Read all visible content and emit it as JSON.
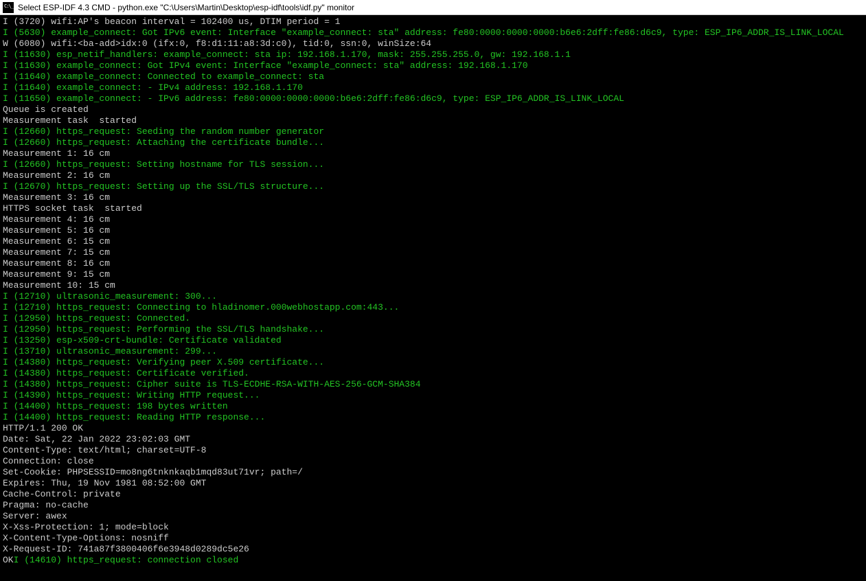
{
  "window": {
    "title": "Select ESP-IDF 4.3 CMD - python.exe  \"C:\\Users\\Martin\\Desktop\\esp-idf\\tools\\idf.py\" monitor"
  },
  "lines": [
    {
      "cls": "plain",
      "text": "I (3720) wifi:AP's beacon interval = 102400 us, DTIM period = 1"
    },
    {
      "cls": "info",
      "text": "I (5630) example_connect: Got IPv6 event: Interface \"example_connect: sta\" address: fe80:0000:0000:0000:b6e6:2dff:fe86:d6c9, type: ESP_IP6_ADDR_IS_LINK_LOCAL"
    },
    {
      "cls": "plain",
      "text": "W (6080) wifi:<ba-add>idx:0 (ifx:0, f8:d1:11:a8:3d:c0), tid:0, ssn:0, winSize:64"
    },
    {
      "cls": "info",
      "text": "I (11630) esp_netif_handlers: example_connect: sta ip: 192.168.1.170, mask: 255.255.255.0, gw: 192.168.1.1"
    },
    {
      "cls": "info",
      "text": "I (11630) example_connect: Got IPv4 event: Interface \"example_connect: sta\" address: 192.168.1.170"
    },
    {
      "cls": "info",
      "text": "I (11640) example_connect: Connected to example_connect: sta"
    },
    {
      "cls": "info",
      "text": "I (11640) example_connect: - IPv4 address: 192.168.1.170"
    },
    {
      "cls": "info",
      "text": "I (11650) example_connect: - IPv6 address: fe80:0000:0000:0000:b6e6:2dff:fe86:d6c9, type: ESP_IP6_ADDR_IS_LINK_LOCAL"
    },
    {
      "cls": "plain",
      "text": "Queue is created"
    },
    {
      "cls": "plain",
      "text": "Measurement task  started"
    },
    {
      "cls": "info",
      "text": "I (12660) https_request: Seeding the random number generator"
    },
    {
      "cls": "info",
      "text": "I (12660) https_request: Attaching the certificate bundle..."
    },
    {
      "cls": "plain",
      "text": "Measurement 1: 16 cm"
    },
    {
      "cls": "info",
      "text": "I (12660) https_request: Setting hostname for TLS session..."
    },
    {
      "cls": "plain",
      "text": "Measurement 2: 16 cm"
    },
    {
      "cls": "info",
      "text": "I (12670) https_request: Setting up the SSL/TLS structure..."
    },
    {
      "cls": "plain",
      "text": "Measurement 3: 16 cm"
    },
    {
      "cls": "plain",
      "text": "HTTPS socket task  started"
    },
    {
      "cls": "plain",
      "text": "Measurement 4: 16 cm"
    },
    {
      "cls": "plain",
      "text": "Measurement 5: 16 cm"
    },
    {
      "cls": "plain",
      "text": "Measurement 6: 15 cm"
    },
    {
      "cls": "plain",
      "text": "Measurement 7: 15 cm"
    },
    {
      "cls": "plain",
      "text": "Measurement 8: 16 cm"
    },
    {
      "cls": "plain",
      "text": "Measurement 9: 15 cm"
    },
    {
      "cls": "plain",
      "text": "Measurement 10: 15 cm"
    },
    {
      "cls": "info",
      "text": "I (12710) ultrasonic_measurement: 300..."
    },
    {
      "cls": "info",
      "text": "I (12710) https_request: Connecting to hladinomer.000webhostapp.com:443..."
    },
    {
      "cls": "info",
      "text": "I (12950) https_request: Connected."
    },
    {
      "cls": "info",
      "text": "I (12950) https_request: Performing the SSL/TLS handshake..."
    },
    {
      "cls": "info",
      "text": "I (13250) esp-x509-crt-bundle: Certificate validated"
    },
    {
      "cls": "info",
      "text": "I (13710) ultrasonic_measurement: 299..."
    },
    {
      "cls": "info",
      "text": "I (14380) https_request: Verifying peer X.509 certificate..."
    },
    {
      "cls": "info",
      "text": "I (14380) https_request: Certificate verified."
    },
    {
      "cls": "info",
      "text": "I (14380) https_request: Cipher suite is TLS-ECDHE-RSA-WITH-AES-256-GCM-SHA384"
    },
    {
      "cls": "info",
      "text": "I (14390) https_request: Writing HTTP request..."
    },
    {
      "cls": "info",
      "text": "I (14400) https_request: 198 bytes written"
    },
    {
      "cls": "info",
      "text": "I (14400) https_request: Reading HTTP response..."
    },
    {
      "cls": "plain",
      "text": "HTTP/1.1 200 OK"
    },
    {
      "cls": "plain",
      "text": "Date: Sat, 22 Jan 2022 23:02:03 GMT"
    },
    {
      "cls": "plain",
      "text": "Content-Type: text/html; charset=UTF-8"
    },
    {
      "cls": "plain",
      "text": "Connection: close"
    },
    {
      "cls": "plain",
      "text": "Set-Cookie: PHPSESSID=mo8ng6tnknkaqb1mqd83ut71vr; path=/"
    },
    {
      "cls": "plain",
      "text": "Expires: Thu, 19 Nov 1981 08:52:00 GMT"
    },
    {
      "cls": "plain",
      "text": "Cache-Control: private"
    },
    {
      "cls": "plain",
      "text": "Pragma: no-cache"
    },
    {
      "cls": "plain",
      "text": "Server: awex"
    },
    {
      "cls": "plain",
      "text": "X-Xss-Protection: 1; mode=block"
    },
    {
      "cls": "plain",
      "text": "X-Content-Type-Options: nosniff"
    },
    {
      "cls": "plain",
      "text": "X-Request-ID: 741a87f3800406f6e3948d0289dc5e26"
    },
    {
      "cls": "plain",
      "text": ""
    }
  ],
  "last_line": {
    "prefix": "OK",
    "suffix": "I (14610) https_request: connection closed"
  }
}
